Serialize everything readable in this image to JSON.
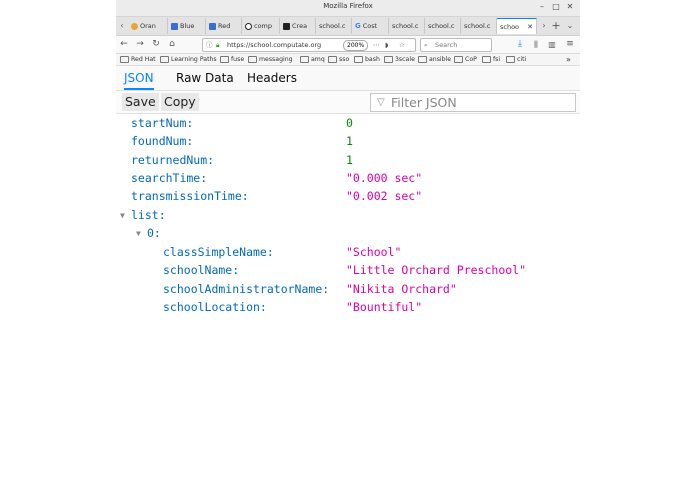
{
  "window": {
    "title": "Mozilla Firefox"
  },
  "tabs": [
    {
      "label": "Oran",
      "color": "#e8a33a"
    },
    {
      "label": "Blue",
      "color": "#3a6fcf"
    },
    {
      "label": "Red",
      "color": "#3a6fcf"
    },
    {
      "label": "comp",
      "color": "#222222"
    },
    {
      "label": "Crea",
      "color": "#222222"
    },
    {
      "label": "school.c",
      "color": ""
    },
    {
      "label": "Cost",
      "color": "#4285f4"
    },
    {
      "label": "school.c",
      "color": ""
    },
    {
      "label": "school.c",
      "color": ""
    },
    {
      "label": "school.c",
      "color": ""
    },
    {
      "label": "schoo",
      "color": "",
      "active": true
    }
  ],
  "nav": {
    "url": "https://school.computate.org",
    "zoom": "200%",
    "search_placeholder": "Search"
  },
  "bookmarks": [
    "Red Hat",
    "Learning Paths",
    "fuse",
    "messaging",
    "amq",
    "sso",
    "bash",
    "3scale",
    "ansible",
    "CoP",
    "fsi",
    "citi"
  ],
  "viewer_tabs": {
    "json": "JSON",
    "raw": "Raw Data",
    "headers": "Headers"
  },
  "viewer_toolbar": {
    "save": "Save",
    "copy": "Copy",
    "filter_placeholder": "Filter JSON"
  },
  "json_rows": {
    "startNum": {
      "key": "startNum:",
      "value": "0"
    },
    "foundNum": {
      "key": "foundNum:",
      "value": "1"
    },
    "returnedNum": {
      "key": "returnedNum:",
      "value": "1"
    },
    "searchTime": {
      "key": "searchTime:",
      "value": "\"0.000 sec\""
    },
    "transmissionTime": {
      "key": "transmissionTime:",
      "value": "\"0.002 sec\""
    },
    "list": {
      "key": "list:"
    },
    "item0": {
      "key": "0:"
    },
    "classSimpleName": {
      "key": "classSimpleName:",
      "value": "\"School\""
    },
    "schoolName": {
      "key": "schoolName:",
      "value": "\"Little Orchard Preschool\""
    },
    "schoolAdministratorName": {
      "key": "schoolAdministratorName:",
      "value": "\"Nikita Orchard\""
    },
    "schoolLocation": {
      "key": "schoolLocation:",
      "value": "\"Bountiful\""
    }
  }
}
